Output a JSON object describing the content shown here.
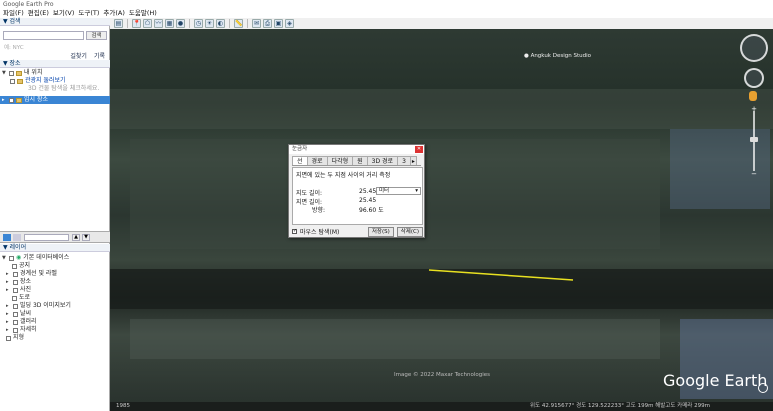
{
  "window": {
    "title": "Google Earth Pro"
  },
  "menu": [
    "파일(F)",
    "편집(E)",
    "보기(V)",
    "도구(T)",
    "추가(A)",
    "도움말(H)"
  ],
  "search": {
    "header": "검색",
    "button": "검색",
    "hint": "예: NYC",
    "links": [
      "길찾기",
      "기록"
    ]
  },
  "places": {
    "header": "장소",
    "items": [
      {
        "label": "내 위치",
        "level": 0
      },
      {
        "label": "관광지 둘러보기",
        "level": 1
      },
      {
        "label": "3D 건물 탐색을 체크하세요.",
        "level": 2
      },
      {
        "label": "임시 장소",
        "level": 0,
        "selected": true
      }
    ]
  },
  "layers": {
    "header": "레이어",
    "items": [
      {
        "label": "기본 데이터베이스",
        "level": 0
      },
      {
        "label": "공지",
        "level": 1
      },
      {
        "label": "경계선 및 라벨",
        "level": 1
      },
      {
        "label": "장소",
        "level": 1
      },
      {
        "label": "사진",
        "level": 1
      },
      {
        "label": "도로",
        "level": 1
      },
      {
        "label": "빌딩 3D 이미지보기",
        "level": 1
      },
      {
        "label": "날씨",
        "level": 1
      },
      {
        "label": "갤러리",
        "level": 1
      },
      {
        "label": "자세히",
        "level": 1
      },
      {
        "label": "지형",
        "level": 0
      }
    ]
  },
  "map": {
    "place_label": "Angkuk Design Studio",
    "copyright": "Image © 2022 Maxar Technologies",
    "logo": "Google Earth",
    "status": "위도  42.915677°  경도 129.522233°  고도  199m   해발고도  카메라  299m",
    "status_left": "1985"
  },
  "ruler": {
    "title": "눈금자",
    "tabs": [
      "선",
      "경로",
      "다각형",
      "원",
      "3D 경로",
      "3"
    ],
    "active_tab": "선",
    "description": "지면에 있는 두 지점 사이의 거리 측정",
    "map_length_label": "지도 길이:",
    "map_length_value": "25.45",
    "unit": "미터",
    "ground_length_label": "지면 길이:",
    "ground_length_value": "25.45",
    "heading_label": "방향:",
    "heading_value": "96.60 도",
    "mouse_nav_label": "마우스 탐색(M)",
    "save_label": "저장(S)",
    "clear_label": "삭제(C)"
  }
}
